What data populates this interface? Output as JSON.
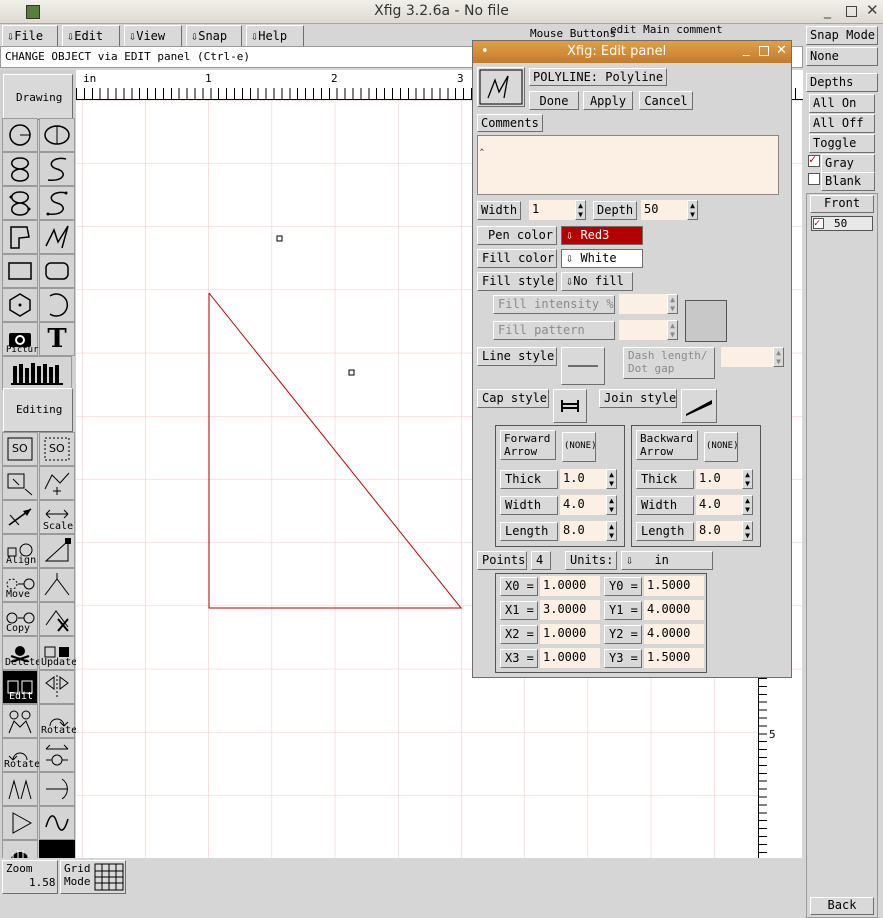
{
  "window": {
    "title": "Xfig 3.2.6a - No file"
  },
  "menu": {
    "items": [
      "File",
      "Edit",
      "View",
      "Snap",
      "Help"
    ]
  },
  "message": "CHANGE OBJECT via EDIT panel   (Ctrl-e)",
  "mouse_buttons": {
    "label": "Mouse Buttons",
    "hint": "edit Main comment"
  },
  "modes": {
    "drawing": "Drawing",
    "editing": "Editing"
  },
  "tool_labels": {
    "picture": "Picture",
    "scale": "Scale",
    "align": "Align",
    "move": "Move",
    "copy": "Copy",
    "delete": "Delete",
    "update": "Update",
    "edit": "Edit",
    "rotate1": "Rotate",
    "rotate2": "Rotate"
  },
  "ruler": {
    "unit": "in",
    "top_ticks": [
      "1",
      "2",
      "3"
    ],
    "side_tick": "5"
  },
  "bottom": {
    "zoom_label": "Zoom",
    "zoom_value": "1.58",
    "grid_label": "Grid\nMode"
  },
  "right_panel": {
    "snap_mode": "Snap Mode",
    "snap_value": "None",
    "depths": "Depths",
    "all_on": "All On",
    "all_off": "All Off",
    "toggle": "Toggle",
    "gray": "Gray",
    "blank": "Blank",
    "front": "Front",
    "depth_item": "50",
    "back": "Back"
  },
  "dialog": {
    "title": "Xfig: Edit panel",
    "object": "POLYLINE: Polyline",
    "done": "Done",
    "apply": "Apply",
    "cancel": "Cancel",
    "comments_label": "Comments",
    "width_label": "Width",
    "width_value": "1",
    "depth_label": "Depth",
    "depth_value": "50",
    "pen_color_label": "Pen color",
    "pen_color_value": "Red3",
    "fill_color_label": "Fill color",
    "fill_color_value": "White",
    "fill_style_label": "Fill style",
    "fill_style_value": "No fill",
    "fill_intensity_label": "Fill intensity %",
    "fill_pattern_label": "Fill pattern",
    "line_style_label": "Line style",
    "dash_label": "Dash length/\nDot gap",
    "cap_style_label": "Cap style",
    "join_style_label": "Join style",
    "forward_arrow": "Forward\nArrow",
    "backward_arrow": "Backward\nArrow",
    "none": "(NONE)",
    "thick_label": "Thick",
    "arrow_width_label": "Width",
    "length_label": "Length",
    "fwd_thick": "1.0",
    "fwd_width": "4.0",
    "fwd_length": "8.0",
    "bwd_thick": "1.0",
    "bwd_width": "4.0",
    "bwd_length": "8.0",
    "points_label": "Points",
    "points_value": "4",
    "units_label": "Units:",
    "units_value": "in",
    "points": [
      {
        "xl": "X0 =",
        "x": "1.0000",
        "yl": "Y0 =",
        "y": "1.5000"
      },
      {
        "xl": "X1 =",
        "x": "3.0000",
        "yl": "Y1 =",
        "y": "4.0000"
      },
      {
        "xl": "X2 =",
        "x": "1.0000",
        "yl": "Y2 =",
        "y": "4.0000"
      },
      {
        "xl": "X3 =",
        "x": "1.0000",
        "yl": "Y3 =",
        "y": "1.5000"
      }
    ]
  },
  "colors": {
    "pen": "#b30000",
    "titlebar": "#c57b2b",
    "grid": "#f4c4c4"
  }
}
